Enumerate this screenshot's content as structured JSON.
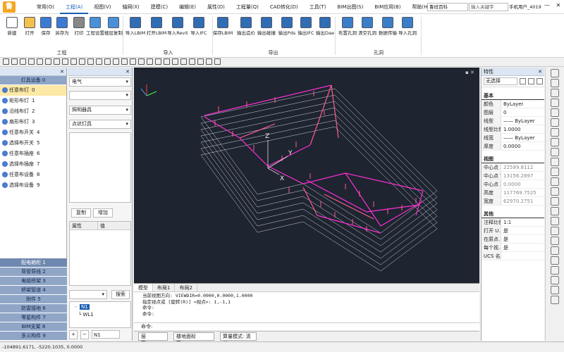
{
  "menubar": {
    "items": [
      "常用(O)",
      "工程(A)",
      "视图(V)",
      "轴网(X)",
      "建模(C)",
      "编辑(E)",
      "属性(D)",
      "工程量(Q)",
      "CAD转化(D)",
      "工具(T)",
      "BIM出图(S)",
      "BIM应用(B)",
      "帮助(H)"
    ],
    "active_index": 1,
    "search_scope": "鲁班百科",
    "search_placeholder": "输入关键字",
    "user": "手机用户_4019"
  },
  "ribbon": {
    "tools": [
      {
        "label": "新建",
        "icon": "new-file-icon",
        "color": "#ffffff"
      },
      {
        "label": "打开",
        "icon": "open-folder-icon",
        "color": "#f2c14e"
      },
      {
        "label": "保存",
        "icon": "save-icon",
        "color": "#3b7bd4"
      },
      {
        "label": "另存为",
        "icon": "save-as-icon",
        "color": "#3b7bd4"
      },
      {
        "label": "打印",
        "icon": "print-icon",
        "color": "#888888"
      },
      {
        "label": "工程设置",
        "icon": "project-settings-icon",
        "color": "#4a90d9"
      },
      {
        "label": "楼层复制",
        "icon": "floor-copy-icon",
        "color": "#4a90d9"
      },
      {
        "label": "导入LBIM",
        "icon": "import-lbim-icon",
        "color": "#2f6db5"
      },
      {
        "label": "打开LBIM",
        "icon": "open-lbim-icon",
        "color": "#2f6db5"
      },
      {
        "label": "导入Revit",
        "icon": "import-revit-icon",
        "color": "#2f6db5"
      },
      {
        "label": "导入IFC",
        "icon": "import-ifc-icon",
        "color": "#2f6db5"
      },
      {
        "label": "保存LBIM",
        "icon": "save-lbim-icon",
        "color": "#2f6db5"
      },
      {
        "label": "输出造价",
        "icon": "export-cost-icon",
        "color": "#2f6db5"
      },
      {
        "label": "输出碰撞",
        "icon": "export-collision-icon",
        "color": "#2f6db5"
      },
      {
        "label": "输出Pds",
        "icon": "export-pds-icon",
        "color": "#2f6db5"
      },
      {
        "label": "输出IFC",
        "icon": "export-ifc-icon",
        "color": "#2f6db5"
      },
      {
        "label": "输出Dae",
        "icon": "export-dae-icon",
        "color": "#2f6db5"
      },
      {
        "label": "布置孔洞",
        "icon": "place-hole-icon",
        "color": "#3a7ec7"
      },
      {
        "label": "清空孔洞",
        "icon": "clear-hole-icon",
        "color": "#3a7ec7"
      },
      {
        "label": "数据传输",
        "icon": "data-transfer-icon",
        "color": "#3a7ec7"
      },
      {
        "label": "导入孔洞",
        "icon": "import-hole-icon",
        "color": "#3a7ec7"
      }
    ],
    "groups": [
      "工程",
      "导入",
      "导出",
      "孔洞"
    ]
  },
  "left_panel": {
    "title": "",
    "top_category": "灯具设备  0",
    "items": [
      {
        "label": "任意布灯",
        "num": "0",
        "icon": "light-fixture-icon"
      },
      {
        "label": "矩形布灯",
        "num": "1",
        "icon": "grid-lights-icon"
      },
      {
        "label": "沿线布灯",
        "num": "2",
        "icon": "line-lights-icon"
      },
      {
        "label": "扇形布灯",
        "num": "3",
        "icon": "fan-lights-icon"
      },
      {
        "label": "任意布开关",
        "num": "4",
        "icon": "switch-icon"
      },
      {
        "label": "选择布开关",
        "num": "5",
        "icon": "select-switch-icon"
      },
      {
        "label": "任意布插座",
        "num": "6",
        "icon": "socket-icon"
      },
      {
        "label": "选择布插座",
        "num": "7",
        "icon": "select-socket-icon"
      },
      {
        "label": "任意布设备",
        "num": "8",
        "icon": "device-icon"
      },
      {
        "label": "选择布设备",
        "num": "9",
        "icon": "select-device-icon"
      }
    ],
    "bottom_categories": [
      "配电箱柜  1",
      "导管导线  2",
      "电缆桥架  3",
      "桥架管道  4",
      "附件  5",
      "防雷接地  6",
      "零星构件  7",
      "BIM支架  8",
      "多义构件  9"
    ]
  },
  "mid_panel": {
    "discipline": "电气",
    "sub": "",
    "type": "照明器具",
    "family": "点状灯具",
    "copy_btn": "复制",
    "add_btn": "增加",
    "attr_col": "属性",
    "val_col": "值",
    "search_btn": "搜索",
    "tree": [
      "N1",
      "WL1"
    ],
    "footer_text": "N1"
  },
  "canvas": {
    "background": "#1e2430",
    "label_z": "Z",
    "label_y": "Y",
    "label_x": "X"
  },
  "cmd_tabs": [
    "模型",
    "布局1",
    "布局2"
  ],
  "cmd_lines": [
    "当前视图方向: VIEWDIR=0.0000,0.0000,1.0000",
    "指定视点或 [旋转(R)] <视点>: 1,-1,1",
    "命令:",
    "命令:"
  ],
  "prompt": "命令:",
  "status": {
    "floor": "层高:2500",
    "floor_elev": "楼地面标高:-600",
    "calc_mode": "算量模式: 清单"
  },
  "props": {
    "title": "特性",
    "selection": "无选择",
    "section_basic": "基本",
    "basic": [
      {
        "k": "颜色",
        "v": "ByLayer"
      },
      {
        "k": "图层",
        "v": "0"
      },
      {
        "k": "线型",
        "v": "—— ByLayer"
      },
      {
        "k": "线型比例",
        "v": "1.0000"
      },
      {
        "k": "线宽",
        "v": "—— ByLayer"
      },
      {
        "k": "厚度",
        "v": "0.0000"
      }
    ],
    "section_view": "视图",
    "view": [
      {
        "k": "中心点 X",
        "v": "22599.8112"
      },
      {
        "k": "中心点 Y",
        "v": "13156.2897"
      },
      {
        "k": "中心点 Z",
        "v": "0.0000"
      },
      {
        "k": "高度",
        "v": "117769.7525"
      },
      {
        "k": "宽度",
        "v": "62970.2751"
      }
    ],
    "section_other": "其他",
    "other": [
      {
        "k": "注释比例",
        "v": "1:1"
      },
      {
        "k": "打开 U...",
        "v": "是"
      },
      {
        "k": "在原点...",
        "v": "是"
      },
      {
        "k": "每个视...",
        "v": "是"
      },
      {
        "k": "UCS 名...",
        "v": ""
      }
    ]
  },
  "bottom_bar": {
    "coords": "-104891.6171, -5220.1035, 0.0000"
  },
  "colors": {
    "accent": "#1a5fb4",
    "category": "#8fa6c7",
    "selected_item": "#fde9a6",
    "magenta": "#ff2fd6",
    "pink": "#ff5d8f"
  }
}
